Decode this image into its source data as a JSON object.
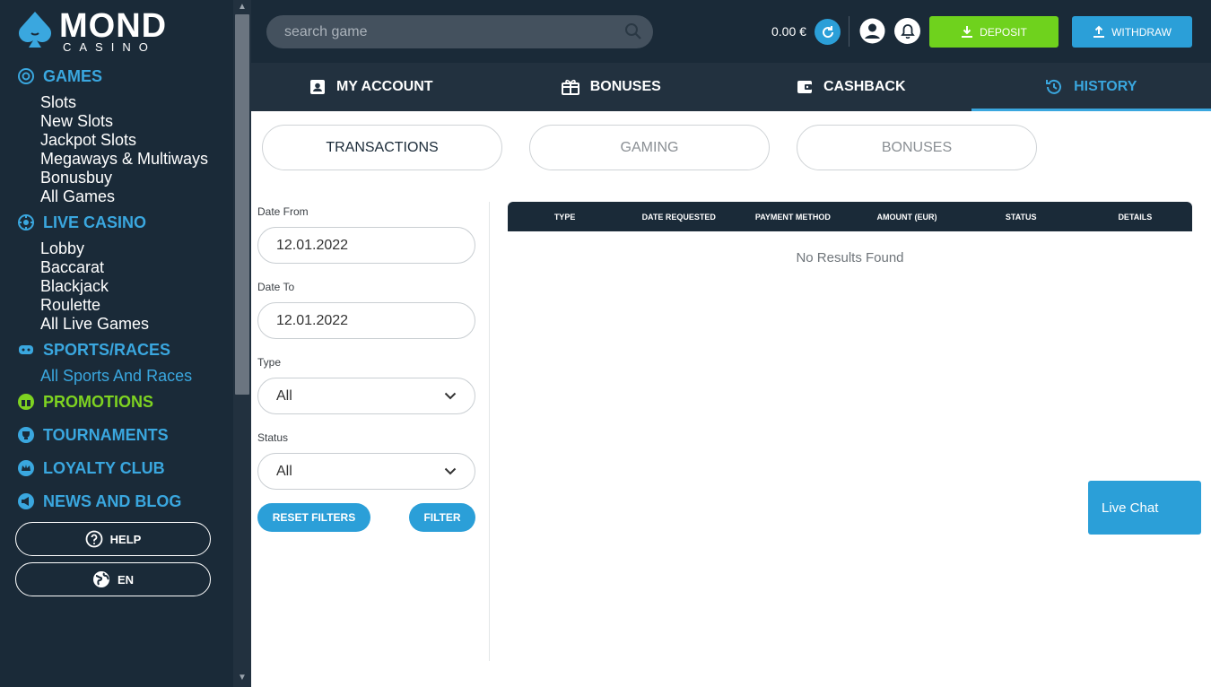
{
  "sidebar": {
    "logo": {
      "main": "MOND",
      "sub": "CASINO"
    },
    "sections": {
      "games": {
        "label": "GAMES",
        "items": [
          "Slots",
          "New Slots",
          "Jackpot Slots",
          "Megaways & Multiways",
          "Bonusbuy",
          "All Games"
        ]
      },
      "live_casino": {
        "label": "LIVE CASINO",
        "items": [
          "Lobby",
          "Baccarat",
          "Blackjack",
          "Roulette",
          "All Live Games"
        ]
      },
      "sports": {
        "label": "SPORTS/RACES",
        "items": [
          "All Sports And Races"
        ]
      },
      "promotions": {
        "label": "PROMOTIONS"
      },
      "tournaments": {
        "label": "TOURNAMENTS"
      },
      "loyalty": {
        "label": "LOYALTY CLUB"
      },
      "news": {
        "label": "NEWS AND BLOG"
      }
    },
    "help_label": "HELP",
    "language_label": "EN"
  },
  "header": {
    "search_placeholder": "search game",
    "balance": "0.00 €",
    "deposit_label": "DEPOSIT",
    "withdraw_label": "WITHDRAW"
  },
  "tabs": [
    {
      "label": "MY ACCOUNT"
    },
    {
      "label": "BONUSES"
    },
    {
      "label": "CASHBACK"
    },
    {
      "label": "HISTORY",
      "active": true
    }
  ],
  "subtabs": [
    {
      "label": "TRANSACTIONS",
      "active": true
    },
    {
      "label": "GAMING"
    },
    {
      "label": "BONUSES"
    }
  ],
  "filters": {
    "date_from_label": "Date From",
    "date_from_value": "12.01.2022",
    "date_to_label": "Date To",
    "date_to_value": "12.01.2022",
    "type_label": "Type",
    "type_value": "All",
    "status_label": "Status",
    "status_value": "All",
    "reset_label": "RESET FILTERS",
    "filter_label": "FILTER"
  },
  "table": {
    "columns": [
      "TYPE",
      "DATE REQUESTED",
      "PAYMENT METHOD",
      "AMOUNT (EUR)",
      "STATUS",
      "DETAILS"
    ],
    "empty_message": "No Results Found"
  },
  "live_chat_label": "Live Chat",
  "colors": {
    "sidebar_bg": "#1a2a38",
    "accent_blue": "#3aa7df",
    "accent_green": "#7ed321",
    "deposit_green": "#6fd21d"
  }
}
